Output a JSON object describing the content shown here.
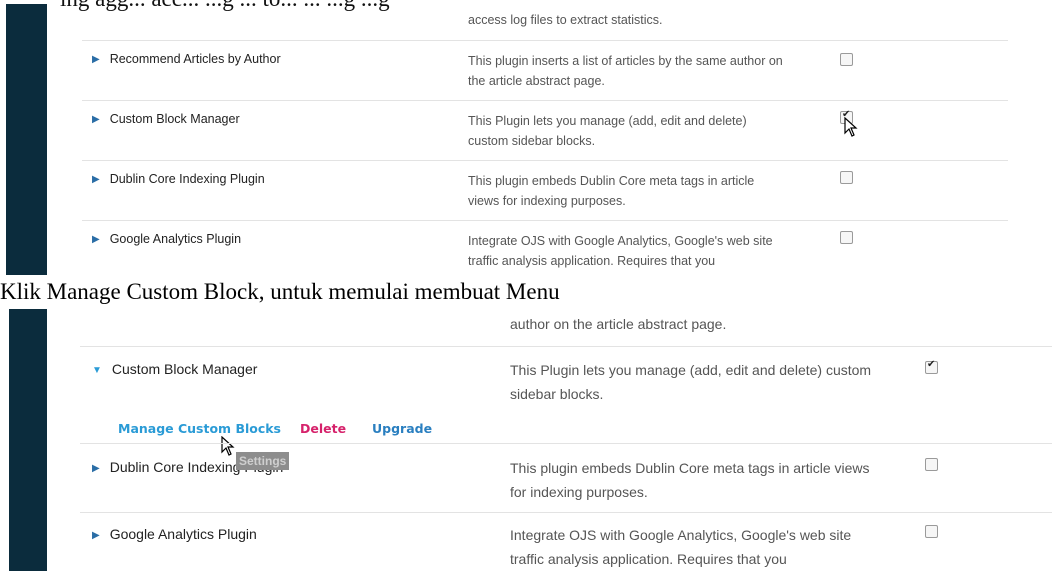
{
  "screenshot1": {
    "top_partial_text": "access log files to extract statistics.",
    "top_cropped_text": "ing agg... acc... ...g ... to... ... ...g ...g",
    "plugins": [
      {
        "name": "Recommend Articles by Author",
        "desc": "This plugin inserts a list of articles by the same author on the article abstract page.",
        "checked": false
      },
      {
        "name": "Custom Block Manager",
        "desc": "This Plugin lets you manage (add, edit and delete) custom sidebar blocks.",
        "checked": true
      },
      {
        "name": "Dublin Core Indexing Plugin",
        "desc": "This plugin embeds Dublin Core meta tags in article views for indexing purposes.",
        "checked": false
      },
      {
        "name": "Google Analytics Plugin",
        "desc": "Integrate OJS with Google Analytics, Google's web site traffic analysis application. Requires that you",
        "checked": false
      }
    ]
  },
  "caption": "Klik Manage Custom Block, untuk memulai membuat Menu",
  "screenshot2": {
    "top_partial_text": "author on the article abstract page.",
    "plugins": [
      {
        "name": "Custom Block Manager",
        "desc": "This Plugin lets you manage (add, edit and delete) custom sidebar blocks.",
        "checked": true,
        "expanded": true
      },
      {
        "name": "Dublin Core Indexing Plugin",
        "desc": "This plugin embeds Dublin Core meta tags in article views for indexing purposes.",
        "checked": false
      },
      {
        "name": "Google Analytics Plugin",
        "desc": "Integrate OJS with Google Analytics, Google's web site traffic analysis application. Requires that you",
        "checked": false
      }
    ],
    "actions": {
      "manage": "Manage Custom Blocks",
      "delete": "Delete",
      "upgrade": "Upgrade"
    },
    "tooltip": "Settings",
    "colors": {
      "manage": "#2a9bd6",
      "delete": "#d6226b",
      "upgrade": "#2a7fc0"
    }
  }
}
